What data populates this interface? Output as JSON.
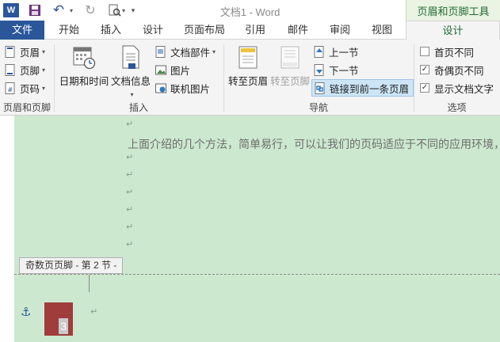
{
  "app": {
    "word_logo": "W",
    "window_title": "文档1 - Word",
    "context_tab_title": "页眉和页脚工具"
  },
  "tabs": [
    "文件",
    "开始",
    "插入",
    "设计",
    "页面布局",
    "引用",
    "邮件",
    "审阅",
    "视图",
    "设计"
  ],
  "ribbon": {
    "header_footer": {
      "header": "页眉",
      "footer": "页脚",
      "page_number": "页码",
      "label": "页眉和页脚"
    },
    "insert": {
      "date_time": "日期和时间",
      "doc_info": "文档信息",
      "doc_parts": "文档部件",
      "picture": "图片",
      "online_picture": "联机图片",
      "label": "插入"
    },
    "navigation": {
      "goto_header": "转至页眉",
      "goto_footer": "转至页脚",
      "prev_section": "上一节",
      "next_section": "下一节",
      "link_previous": "链接到前一条页眉",
      "label": "导航"
    },
    "options": {
      "first_page_different": "首页不同",
      "odd_even_different": "奇偶页不同",
      "show_doc_text": "显示文档文字",
      "label": "选项",
      "first_page_checked": false,
      "odd_even_checked": true,
      "show_doc_text_checked": true
    }
  },
  "document": {
    "body_text": "上面介绍的几个方法，简单易行，可以让我们的页码适应于不同的应用环境，还",
    "paragraph_mark": "↵",
    "footer_label": "奇数页页脚 - 第 2 节 -",
    "page_number": "3"
  },
  "colors": {
    "accent": "#2b579a",
    "page_bg": "#cce8cf",
    "context_green": "#1f6b36",
    "page_number_box": "#a13c3c"
  }
}
